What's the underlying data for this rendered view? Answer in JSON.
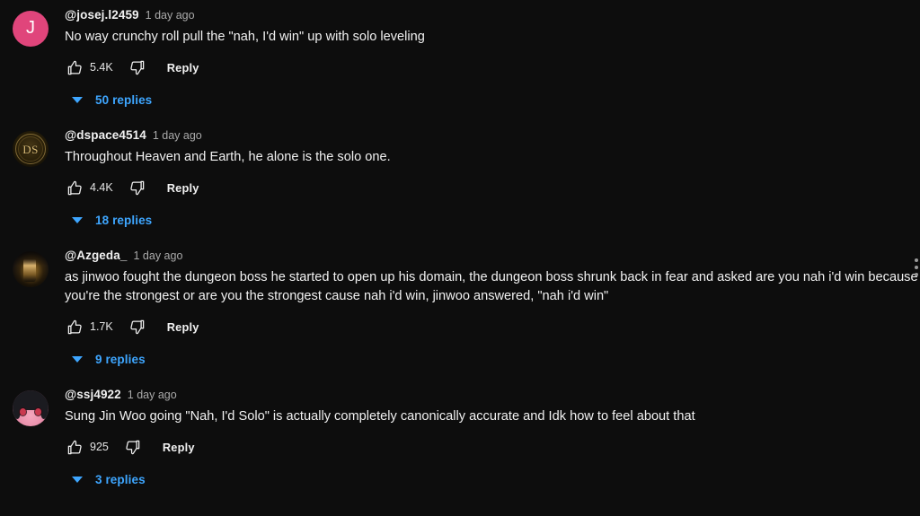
{
  "app": {
    "surface": "youtube-comments",
    "background_color": "#0d0d0d",
    "text_color": "#f1f1f1",
    "link_color": "#3ea6ff",
    "muted_text_color": "#aaaaaa"
  },
  "labels": {
    "reply": "Reply",
    "like_icon": "thumbs-up-icon",
    "dislike_icon": "thumbs-down-icon",
    "expand_icon": "chevron-down-icon"
  },
  "comments": [
    {
      "author": "@josej.l2459",
      "timestamp": "1 day ago",
      "text": "No way crunchy roll pull the \"nah, I'd win\" up with solo leveling",
      "likes": "5.4K",
      "reply_label": "Reply",
      "replies_label": "50 replies",
      "avatar": {
        "type": "letter",
        "letter": "J",
        "color": "#e0457b"
      }
    },
    {
      "author": "@dspace4514",
      "timestamp": "1 day ago",
      "text": "Throughout Heaven and Earth, he alone is the solo one.",
      "likes": "4.4K",
      "reply_label": "Reply",
      "replies_label": "18 replies",
      "avatar": {
        "type": "monogram",
        "letter": "DS",
        "color": "#d9bb76"
      }
    },
    {
      "author": "@Azgeda_",
      "timestamp": "1 day ago",
      "text": "as jinwoo fought the dungeon boss he started to open up his domain, the dungeon boss shrunk back in fear and asked are you nah i'd win because you're the strongest or are you the strongest cause nah i'd win, jinwoo answered, \"nah i'd win\"",
      "likes": "1.7K",
      "reply_label": "Reply",
      "replies_label": "9 replies",
      "avatar": {
        "type": "photo",
        "letter": "",
        "color": "#c79a4a"
      }
    },
    {
      "author": "@ssj4922",
      "timestamp": "1 day ago",
      "text": "Sung Jin Woo going \"Nah, I'd Solo\" is actually completely canonically accurate and Idk how to feel about that",
      "likes": "925",
      "reply_label": "Reply",
      "replies_label": "3 replies",
      "avatar": {
        "type": "anime",
        "letter": "",
        "color": "#e88da9"
      }
    }
  ]
}
